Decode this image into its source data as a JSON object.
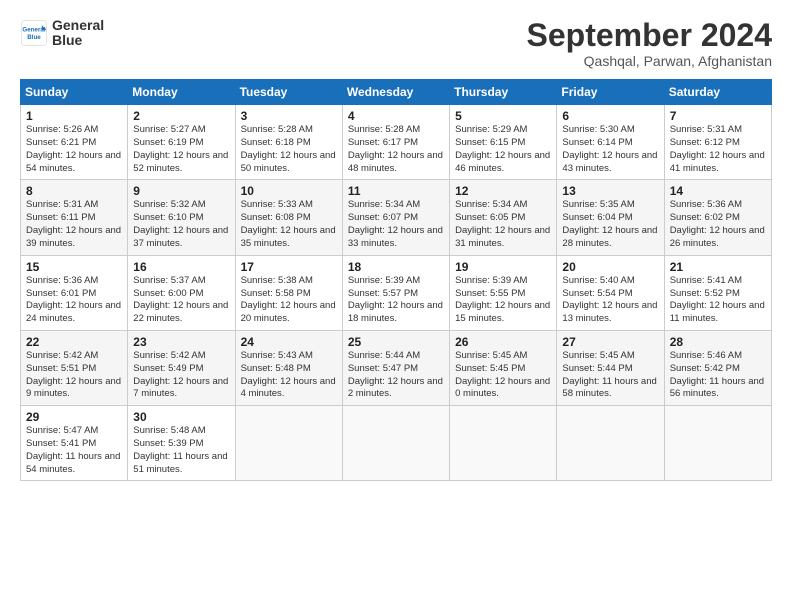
{
  "header": {
    "logo_line1": "General",
    "logo_line2": "Blue",
    "title": "September 2024",
    "subtitle": "Qashqal, Parwan, Afghanistan"
  },
  "columns": [
    "Sunday",
    "Monday",
    "Tuesday",
    "Wednesday",
    "Thursday",
    "Friday",
    "Saturday"
  ],
  "weeks": [
    [
      {
        "day": "1",
        "sunrise": "Sunrise: 5:26 AM",
        "sunset": "Sunset: 6:21 PM",
        "daylight": "Daylight: 12 hours and 54 minutes."
      },
      {
        "day": "2",
        "sunrise": "Sunrise: 5:27 AM",
        "sunset": "Sunset: 6:19 PM",
        "daylight": "Daylight: 12 hours and 52 minutes."
      },
      {
        "day": "3",
        "sunrise": "Sunrise: 5:28 AM",
        "sunset": "Sunset: 6:18 PM",
        "daylight": "Daylight: 12 hours and 50 minutes."
      },
      {
        "day": "4",
        "sunrise": "Sunrise: 5:28 AM",
        "sunset": "Sunset: 6:17 PM",
        "daylight": "Daylight: 12 hours and 48 minutes."
      },
      {
        "day": "5",
        "sunrise": "Sunrise: 5:29 AM",
        "sunset": "Sunset: 6:15 PM",
        "daylight": "Daylight: 12 hours and 46 minutes."
      },
      {
        "day": "6",
        "sunrise": "Sunrise: 5:30 AM",
        "sunset": "Sunset: 6:14 PM",
        "daylight": "Daylight: 12 hours and 43 minutes."
      },
      {
        "day": "7",
        "sunrise": "Sunrise: 5:31 AM",
        "sunset": "Sunset: 6:12 PM",
        "daylight": "Daylight: 12 hours and 41 minutes."
      }
    ],
    [
      {
        "day": "8",
        "sunrise": "Sunrise: 5:31 AM",
        "sunset": "Sunset: 6:11 PM",
        "daylight": "Daylight: 12 hours and 39 minutes."
      },
      {
        "day": "9",
        "sunrise": "Sunrise: 5:32 AM",
        "sunset": "Sunset: 6:10 PM",
        "daylight": "Daylight: 12 hours and 37 minutes."
      },
      {
        "day": "10",
        "sunrise": "Sunrise: 5:33 AM",
        "sunset": "Sunset: 6:08 PM",
        "daylight": "Daylight: 12 hours and 35 minutes."
      },
      {
        "day": "11",
        "sunrise": "Sunrise: 5:34 AM",
        "sunset": "Sunset: 6:07 PM",
        "daylight": "Daylight: 12 hours and 33 minutes."
      },
      {
        "day": "12",
        "sunrise": "Sunrise: 5:34 AM",
        "sunset": "Sunset: 6:05 PM",
        "daylight": "Daylight: 12 hours and 31 minutes."
      },
      {
        "day": "13",
        "sunrise": "Sunrise: 5:35 AM",
        "sunset": "Sunset: 6:04 PM",
        "daylight": "Daylight: 12 hours and 28 minutes."
      },
      {
        "day": "14",
        "sunrise": "Sunrise: 5:36 AM",
        "sunset": "Sunset: 6:02 PM",
        "daylight": "Daylight: 12 hours and 26 minutes."
      }
    ],
    [
      {
        "day": "15",
        "sunrise": "Sunrise: 5:36 AM",
        "sunset": "Sunset: 6:01 PM",
        "daylight": "Daylight: 12 hours and 24 minutes."
      },
      {
        "day": "16",
        "sunrise": "Sunrise: 5:37 AM",
        "sunset": "Sunset: 6:00 PM",
        "daylight": "Daylight: 12 hours and 22 minutes."
      },
      {
        "day": "17",
        "sunrise": "Sunrise: 5:38 AM",
        "sunset": "Sunset: 5:58 PM",
        "daylight": "Daylight: 12 hours and 20 minutes."
      },
      {
        "day": "18",
        "sunrise": "Sunrise: 5:39 AM",
        "sunset": "Sunset: 5:57 PM",
        "daylight": "Daylight: 12 hours and 18 minutes."
      },
      {
        "day": "19",
        "sunrise": "Sunrise: 5:39 AM",
        "sunset": "Sunset: 5:55 PM",
        "daylight": "Daylight: 12 hours and 15 minutes."
      },
      {
        "day": "20",
        "sunrise": "Sunrise: 5:40 AM",
        "sunset": "Sunset: 5:54 PM",
        "daylight": "Daylight: 12 hours and 13 minutes."
      },
      {
        "day": "21",
        "sunrise": "Sunrise: 5:41 AM",
        "sunset": "Sunset: 5:52 PM",
        "daylight": "Daylight: 12 hours and 11 minutes."
      }
    ],
    [
      {
        "day": "22",
        "sunrise": "Sunrise: 5:42 AM",
        "sunset": "Sunset: 5:51 PM",
        "daylight": "Daylight: 12 hours and 9 minutes."
      },
      {
        "day": "23",
        "sunrise": "Sunrise: 5:42 AM",
        "sunset": "Sunset: 5:49 PM",
        "daylight": "Daylight: 12 hours and 7 minutes."
      },
      {
        "day": "24",
        "sunrise": "Sunrise: 5:43 AM",
        "sunset": "Sunset: 5:48 PM",
        "daylight": "Daylight: 12 hours and 4 minutes."
      },
      {
        "day": "25",
        "sunrise": "Sunrise: 5:44 AM",
        "sunset": "Sunset: 5:47 PM",
        "daylight": "Daylight: 12 hours and 2 minutes."
      },
      {
        "day": "26",
        "sunrise": "Sunrise: 5:45 AM",
        "sunset": "Sunset: 5:45 PM",
        "daylight": "Daylight: 12 hours and 0 minutes."
      },
      {
        "day": "27",
        "sunrise": "Sunrise: 5:45 AM",
        "sunset": "Sunset: 5:44 PM",
        "daylight": "Daylight: 11 hours and 58 minutes."
      },
      {
        "day": "28",
        "sunrise": "Sunrise: 5:46 AM",
        "sunset": "Sunset: 5:42 PM",
        "daylight": "Daylight: 11 hours and 56 minutes."
      }
    ],
    [
      {
        "day": "29",
        "sunrise": "Sunrise: 5:47 AM",
        "sunset": "Sunset: 5:41 PM",
        "daylight": "Daylight: 11 hours and 54 minutes."
      },
      {
        "day": "30",
        "sunrise": "Sunrise: 5:48 AM",
        "sunset": "Sunset: 5:39 PM",
        "daylight": "Daylight: 11 hours and 51 minutes."
      },
      null,
      null,
      null,
      null,
      null
    ]
  ]
}
